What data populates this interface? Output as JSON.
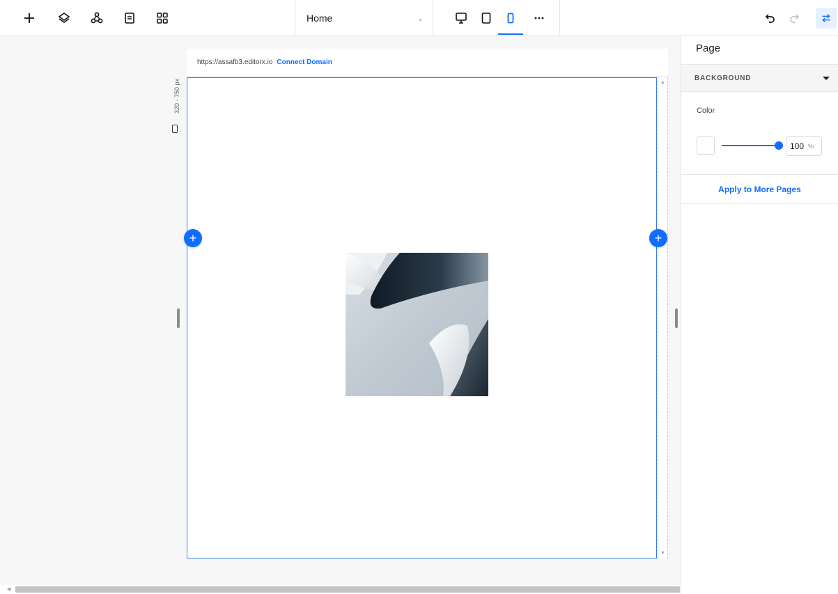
{
  "toolbar": {
    "icons": [
      "add-icon",
      "layers-icon",
      "connections-icon",
      "pages-icon",
      "apps-icon"
    ],
    "page_selector": {
      "value": "Home"
    },
    "device_icons": [
      "desktop-icon",
      "tablet-icon",
      "mobile-icon",
      "more-icon"
    ],
    "active_device": "mobile",
    "undo_redo": [
      "undo-icon",
      "redo-icon"
    ],
    "panel_toggle_icon": "settings-panel-icon"
  },
  "canvas": {
    "site_url": "https://assafb3.editorx.io",
    "connect_domain": "Connect Domain",
    "breakpoint_range": "320 - 750 px"
  },
  "panel": {
    "title": "Page",
    "section": "BACKGROUND",
    "color_label": "Color",
    "color_value": "#ffffff",
    "opacity_value": "100",
    "opacity_unit": "%",
    "opacity_fraction": 1.0,
    "apply_label": "Apply to More Pages"
  },
  "colors": {
    "accent": "#116dff"
  }
}
